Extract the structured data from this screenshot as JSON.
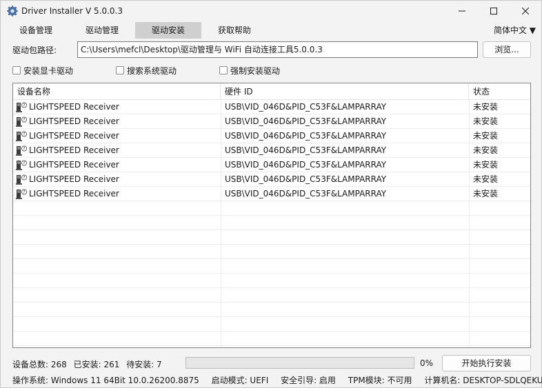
{
  "window": {
    "title": "Driver Installer V 5.0.0.3"
  },
  "menu": {
    "items": [
      {
        "label": "设备管理"
      },
      {
        "label": "驱动管理"
      },
      {
        "label": "驱动安装"
      },
      {
        "label": "获取帮助"
      }
    ],
    "language": "简体中文 ▼"
  },
  "path": {
    "label": "驱动包路径:",
    "value": "C:\\Users\\mefcl\\Desktop\\驱动管理与 WiFi 自动连接工具5.0.0.3",
    "browse_label": "浏览..."
  },
  "options": [
    {
      "label": "安装显卡驱动",
      "checked": false
    },
    {
      "label": "搜索系统驱动",
      "checked": false
    },
    {
      "label": "强制安装驱动",
      "checked": false
    }
  ],
  "table": {
    "columns": [
      "设备名称",
      "硬件 ID",
      "状态"
    ],
    "rows": [
      {
        "name": "LIGHTSPEED Receiver",
        "hwid": "USB\\VID_046D&PID_C53F&LAMPARRAY",
        "status": "未安装"
      },
      {
        "name": "LIGHTSPEED Receiver",
        "hwid": "USB\\VID_046D&PID_C53F&LAMPARRAY",
        "status": "未安装"
      },
      {
        "name": "LIGHTSPEED Receiver",
        "hwid": "USB\\VID_046D&PID_C53F&LAMPARRAY",
        "status": "未安装"
      },
      {
        "name": "LIGHTSPEED Receiver",
        "hwid": "USB\\VID_046D&PID_C53F&LAMPARRAY",
        "status": "未安装"
      },
      {
        "name": "LIGHTSPEED Receiver",
        "hwid": "USB\\VID_046D&PID_C53F&LAMPARRAY",
        "status": "未安装"
      },
      {
        "name": "LIGHTSPEED Receiver",
        "hwid": "USB\\VID_046D&PID_C53F&LAMPARRAY",
        "status": "未安装"
      },
      {
        "name": "LIGHTSPEED Receiver",
        "hwid": "USB\\VID_046D&PID_C53F&LAMPARRAY",
        "status": "未安装"
      }
    ]
  },
  "stats": {
    "total": "设备总数: 268",
    "installed": "已安装: 261",
    "pending": "待安装: 7"
  },
  "progress": {
    "percent": 0,
    "label": "0%"
  },
  "install_button": "开始执行安装",
  "system": {
    "os": "操作系统: Windows 11  64Bit  10.0.26200.8875",
    "boot": "启动模式: UEFI",
    "secure_boot": "安全引导: 启用",
    "tpm": "TPM模块: 不可用",
    "computer": "计算机名: DESKTOP-SDLQEKU"
  },
  "colors": {
    "active_tab": "#cfcfcf",
    "progress_fill": "#06b025"
  }
}
